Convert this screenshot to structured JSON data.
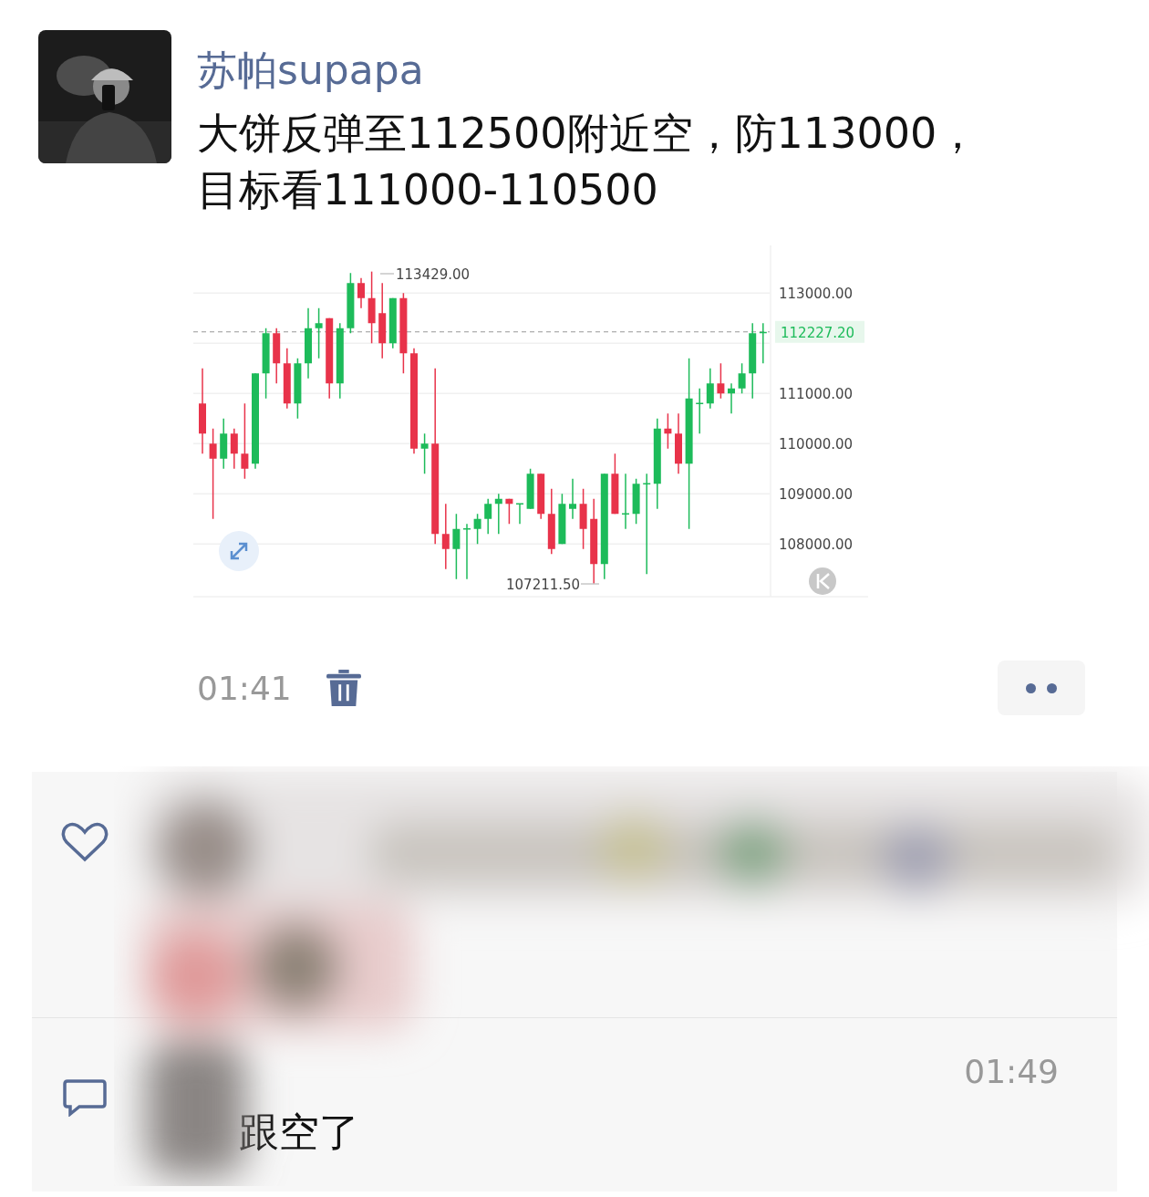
{
  "post": {
    "author": "苏帕supapa",
    "text": "大饼反弹至112500附近空，防113000，目标看111000-110500"
  },
  "chart_image": {
    "high_label": "113429.00",
    "low_label": "107211.50",
    "chart_data": {
      "type": "candlestick",
      "grid": true,
      "ylim": [
        106950,
        113950
      ],
      "ref_lines": [
        {
          "axis": "y",
          "value": 112227.2,
          "label": "112227.20"
        }
      ],
      "yticks": [
        {
          "value": 113000,
          "label": "113000.00"
        },
        {
          "value": 111000,
          "label": "111000.00"
        },
        {
          "value": 110000,
          "label": "110000.00"
        },
        {
          "value": 109000,
          "label": "109000.00"
        },
        {
          "value": 108000,
          "label": "108000.00"
        }
      ],
      "ohlc": [
        [
          110800,
          111500,
          109800,
          110200
        ],
        [
          110000,
          110300,
          108500,
          109700
        ],
        [
          109700,
          110500,
          109500,
          110200
        ],
        [
          110200,
          110300,
          109500,
          109800
        ],
        [
          109800,
          110800,
          109300,
          109500
        ],
        [
          109600,
          111400,
          109500,
          111400
        ],
        [
          111400,
          112300,
          110900,
          112200
        ],
        [
          112200,
          112300,
          111200,
          111600
        ],
        [
          111600,
          111900,
          110700,
          110800
        ],
        [
          110800,
          111700,
          110500,
          111600
        ],
        [
          111600,
          112700,
          111300,
          112300
        ],
        [
          112300,
          112700,
          111700,
          112400
        ],
        [
          112500,
          112500,
          110900,
          111200
        ],
        [
          111200,
          112400,
          110900,
          112300
        ],
        [
          112300,
          113400,
          112200,
          113200
        ],
        [
          113200,
          113300,
          112700,
          112900
        ],
        [
          112900,
          113429,
          112000,
          112400
        ],
        [
          112600,
          113200,
          111700,
          112000
        ],
        [
          112000,
          112900,
          111900,
          112900
        ],
        [
          112900,
          113000,
          111400,
          111800
        ],
        [
          111800,
          111900,
          109800,
          109900
        ],
        [
          109900,
          110200,
          109400,
          110000
        ],
        [
          110000,
          111500,
          108000,
          108200
        ],
        [
          108200,
          108800,
          107500,
          107900
        ],
        [
          107900,
          108600,
          107300,
          108300
        ],
        [
          108300,
          108400,
          107300,
          108300
        ],
        [
          108300,
          108600,
          108000,
          108500
        ],
        [
          108500,
          108900,
          108200,
          108800
        ],
        [
          108800,
          109000,
          108200,
          108900
        ],
        [
          108900,
          108900,
          108400,
          108800
        ],
        [
          108800,
          108800,
          108400,
          108800
        ],
        [
          108700,
          109500,
          108700,
          109400
        ],
        [
          109400,
          109400,
          108500,
          108600
        ],
        [
          108600,
          109100,
          107800,
          107900
        ],
        [
          108000,
          109000,
          108000,
          108800
        ],
        [
          108700,
          109300,
          108500,
          108800
        ],
        [
          108800,
          109100,
          107900,
          108300
        ],
        [
          108500,
          108900,
          107211.5,
          107600
        ],
        [
          107600,
          109400,
          107300,
          109400
        ],
        [
          109400,
          109800,
          108600,
          108600
        ],
        [
          108600,
          109400,
          108300,
          108600
        ],
        [
          108600,
          109300,
          108400,
          109200
        ],
        [
          109200,
          109400,
          107400,
          109200
        ],
        [
          109200,
          110500,
          108700,
          110300
        ],
        [
          110300,
          110600,
          109900,
          110200
        ],
        [
          110200,
          110600,
          109400,
          109600
        ],
        [
          109600,
          111700,
          108300,
          110900
        ],
        [
          110800,
          111100,
          110200,
          110800
        ],
        [
          110800,
          111500,
          110700,
          111200
        ],
        [
          111200,
          111600,
          110900,
          111000
        ],
        [
          111000,
          111200,
          110600,
          111100
        ],
        [
          111100,
          111600,
          111000,
          111400
        ],
        [
          111400,
          112400,
          110900,
          112200
        ],
        [
          112200,
          112400,
          111600,
          112227.2
        ]
      ]
    }
  },
  "time": "01:41",
  "comments": [
    {
      "time": "01:49",
      "text": "跟空了"
    }
  ]
}
